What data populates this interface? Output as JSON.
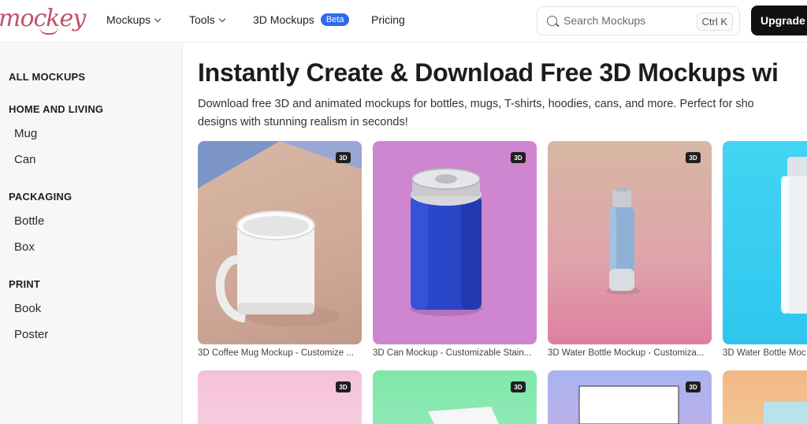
{
  "brand": {
    "name": "mockey"
  },
  "nav": {
    "items": [
      {
        "label": "Mockups"
      },
      {
        "label": "Tools"
      },
      {
        "label": "3D Mockups",
        "badge": "Beta"
      },
      {
        "label": "Pricing"
      }
    ]
  },
  "search": {
    "placeholder": "Search Mockups",
    "shortcut": "Ctrl K"
  },
  "upgrade": {
    "label": "Upgrade"
  },
  "sidebar": {
    "all": "ALL MOCKUPS",
    "groups": [
      {
        "title": "HOME AND LIVING",
        "items": [
          "Mug",
          "Can"
        ]
      },
      {
        "title": "PACKAGING",
        "items": [
          "Bottle",
          "Box"
        ]
      },
      {
        "title": "PRINT",
        "items": [
          "Book",
          "Poster"
        ]
      }
    ]
  },
  "main": {
    "title": "Instantly Create & Download Free 3D Mockups wi",
    "desc_line1": "Download free 3D and animated mockups for bottles, mugs, T-shirts, hoodies, cans, and more. Perfect for sho",
    "desc_line2": "designs with stunning realism in seconds!",
    "badge": "3D",
    "cards": [
      {
        "caption": "3D Coffee Mug Mockup - Customize ..."
      },
      {
        "caption": "3D Can Mockup - Customizable Stain..."
      },
      {
        "caption": "3D Water Bottle Mockup - Customiza..."
      },
      {
        "caption": "3D Water Bottle Moc"
      }
    ]
  },
  "colors": {
    "accent": "#2f6bf0",
    "brand": "#c0506b",
    "dark": "#111111"
  }
}
